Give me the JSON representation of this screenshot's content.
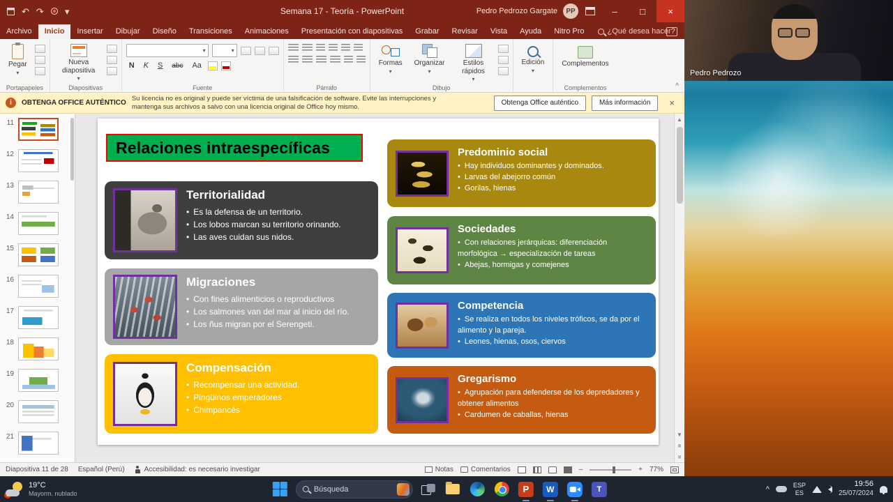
{
  "icons": {
    "dropdown_arrow": "▾",
    "undo": "↶",
    "redo": "↷",
    "minimize": "–",
    "maximize": "□",
    "close": "×",
    "ribbon_collapse": "^",
    "scroll_up": "▲",
    "scroll_down": "▼",
    "prev_slide": "«",
    "next_slide": "»",
    "zoom_out": "–",
    "zoom_in": "+",
    "tray_expand": "^"
  },
  "titlebar": {
    "title": "Semana 17 - Teoría  -  PowerPoint",
    "user_name": "Pedro Pedrozo Gargate",
    "user_initials": "PP"
  },
  "ribbon": {
    "tabs": [
      "Archivo",
      "Inicio",
      "Insertar",
      "Dibujar",
      "Diseño",
      "Transiciones",
      "Animaciones",
      "Presentación con diapositivas",
      "Grabar",
      "Revisar",
      "Vista",
      "Ayuda",
      "Nitro Pro"
    ],
    "search_placeholder": "¿Qué desea hacer?",
    "paste_label": "Pegar",
    "new_slide_label": "Nueva diapositiva",
    "font_bold": "N",
    "font_italic": "K",
    "font_underline": "S",
    "font_strike": "abc",
    "font_case": "Aa",
    "shapes_label": "Formas",
    "arrange_label": "Organizar",
    "quick_styles_label": "Estilos rápidos",
    "editing_label": "Edición",
    "addins_label": "Complementos",
    "group_labels": [
      "Portapapeles",
      "Diapositivas",
      "Fuente",
      "Párrafo",
      "Dibujo",
      "Complementos"
    ]
  },
  "warning": {
    "title": "OBTENGA OFFICE AUTÉNTICO",
    "message": "Su licencia no es original y puede ser víctima de una falsificación de software. Evite las interrupciones y mantenga sus archivos a salvo con una licencia original de Office hoy mismo.",
    "primary_button": "Obtenga Office auténtico",
    "secondary_button": "Más información"
  },
  "thumbnails": {
    "numbers": [
      "11",
      "12",
      "13",
      "14",
      "15",
      "16",
      "17",
      "18",
      "19",
      "20",
      "21"
    ],
    "current": "11"
  },
  "slide": {
    "title": "Relaciones intraespecíficas",
    "title_bg": "#00b050",
    "title_border": "#ff0000",
    "cards": [
      {
        "title": "Territorialidad",
        "bg": "#3f3f3f",
        "image": "wolf",
        "bullets": [
          "Es la defensa de un territorio.",
          "Los lobos marcan su territorio orinando.",
          "Las aves cuidan sus nidos."
        ]
      },
      {
        "title": "Migraciones",
        "bg": "#a6a6a6",
        "image": "salmon-waterfall",
        "bullets": [
          "Con fines alimenticios o reproductivos",
          "Los salmones van del mar al inicio del río.",
          "Los ñus migran por el Serengeti."
        ]
      },
      {
        "title": "Compensación",
        "bg": "#ffc000",
        "image": "emperor-penguin",
        "bullets": [
          "Recompensar una actividad.",
          "Pingüinos emperadores",
          "Chimpancés"
        ]
      },
      {
        "title": "Predominio social",
        "bg": "#a8880f",
        "image": "bumblebee-larvae",
        "bullets": [
          "Hay individuos dominantes y dominados.",
          "Larvas del abejorro común",
          "Gorilas, hienas"
        ]
      },
      {
        "title": "Sociedades",
        "bg": "#5e8544",
        "image": "ant-castes",
        "bullets": [
          "Con relaciones jerárquicas: diferenciación morfológica → especialización de tareas",
          "Abejas, hormigas y comejenes"
        ]
      },
      {
        "title": "Competencia",
        "bg": "#2e75b6",
        "image": "lions-fighting",
        "bullets": [
          "Se realiza en todos los niveles tróficos, se da por el alimento y la pareja.",
          "Leones, hienas, osos, ciervos"
        ]
      },
      {
        "title": "Gregarismo",
        "bg": "#c55a11",
        "image": "fish-school",
        "bullets": [
          "Agrupación para defenderse de los depredadores y obtener alimentos",
          "Cardumen de caballas, hienas"
        ]
      }
    ]
  },
  "statusbar": {
    "slide_position": "Diapositiva 11 de 28",
    "language": "Español (Perú)",
    "accessibility": "Accesibilidad: es necesario investigar",
    "notes_label": "Notas",
    "comments_label": "Comentarios",
    "zoom_level": "77%"
  },
  "webcam": {
    "name_label": "Pedro Pedrozo"
  },
  "taskbar": {
    "weather_temp": "19°C",
    "weather_desc": "Mayorm. nublado",
    "weather_badge": "1",
    "search_label": "Búsqueda",
    "lang_line1": "ESP",
    "lang_line2": "ES",
    "time": "19:56",
    "date": "25/07/2024"
  }
}
